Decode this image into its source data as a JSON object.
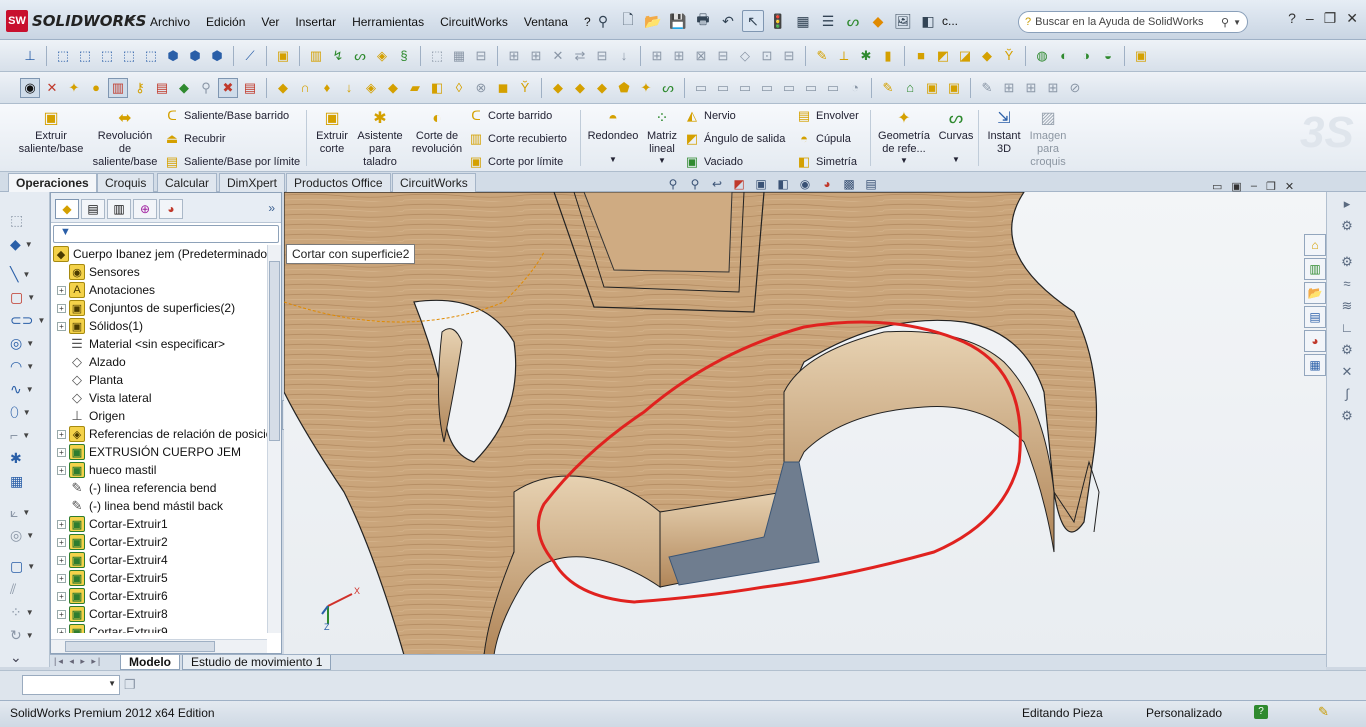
{
  "app": {
    "logo_text": "SOLIDWORKS",
    "logo_mark": "SW"
  },
  "menubar": {
    "items": [
      "Archivo",
      "Edición",
      "Ver",
      "Insertar",
      "Herramientas",
      "CircuitWorks",
      "Ventana",
      "?"
    ]
  },
  "menubar_overflow": "c...",
  "help_search": {
    "placeholder": "Buscar en la Ayuda de SolidWorks"
  },
  "command_manager": {
    "extrude_boss": "Extruir saliente/base",
    "revolve_boss": "Revolución de saliente/base",
    "swept_boss": "Saliente/Base barrido",
    "loft_boss": "Recubrir",
    "boundary_boss": "Saliente/Base por límite",
    "extrude_cut": "Extruir corte",
    "hole_wizard": "Asistente para taladro",
    "revolve_cut": "Corte de revolución",
    "swept_cut": "Corte barrido",
    "loft_cut": "Corte recubierto",
    "boundary_cut": "Corte por límite",
    "fillet": "Redondeo",
    "linear_pattern": "Matriz lineal",
    "rib": "Nervio",
    "draft": "Ángulo de salida",
    "shell": "Vaciado",
    "wrap": "Envolver",
    "dome": "Cúpula",
    "mirror": "Simetría",
    "ref_geometry": "Geometría de refe...",
    "curves": "Curvas",
    "instant3d": "Instant 3D",
    "sketch_picture": "Imagen para croquis"
  },
  "tabs": [
    "Operaciones",
    "Croquis",
    "Calcular",
    "DimXpert",
    "Productos Office",
    "CircuitWorks"
  ],
  "active_tab": "Operaciones",
  "tree": {
    "root": "Cuerpo Ibanez jem  (Predeterminado",
    "items": [
      {
        "label": "Sensores",
        "expandable": false,
        "icon": "sensor-icon"
      },
      {
        "label": "Anotaciones",
        "expandable": true,
        "icon": "annotations-icon"
      },
      {
        "label": "Conjuntos de superficies(2)",
        "expandable": true,
        "icon": "surface-bodies-icon"
      },
      {
        "label": "Sólidos(1)",
        "expandable": true,
        "icon": "solid-bodies-icon"
      },
      {
        "label": "Material <sin especificar>",
        "expandable": false,
        "icon": "material-icon"
      },
      {
        "label": "Alzado",
        "expandable": false,
        "icon": "plane-icon"
      },
      {
        "label": "Planta",
        "expandable": false,
        "icon": "plane-icon"
      },
      {
        "label": "Vista lateral",
        "expandable": false,
        "icon": "plane-icon"
      },
      {
        "label": "Origen",
        "expandable": false,
        "icon": "origin-icon"
      },
      {
        "label": "Referencias de relación de posició",
        "expandable": true,
        "icon": "mate-references-icon"
      },
      {
        "label": "EXTRUSIÓN CUERPO JEM",
        "expandable": true,
        "icon": "extrude-icon"
      },
      {
        "label": "hueco mastil",
        "expandable": true,
        "icon": "cut-icon"
      },
      {
        "label": "(-) linea referencia bend",
        "expandable": false,
        "icon": "sketch-icon"
      },
      {
        "label": "(-) linea bend mástil back",
        "expandable": false,
        "icon": "sketch-icon"
      },
      {
        "label": "Cortar-Extruir1",
        "expandable": true,
        "icon": "cut-icon"
      },
      {
        "label": "Cortar-Extruir2",
        "expandable": true,
        "icon": "cut-icon"
      },
      {
        "label": "Cortar-Extruir4",
        "expandable": true,
        "icon": "cut-icon"
      },
      {
        "label": "Cortar-Extruir5",
        "expandable": true,
        "icon": "cut-icon"
      },
      {
        "label": "Cortar-Extruir6",
        "expandable": true,
        "icon": "cut-icon"
      },
      {
        "label": "Cortar-Extruir8",
        "expandable": true,
        "icon": "cut-icon"
      },
      {
        "label": "Cortar-Extruir9",
        "expandable": true,
        "icon": "cut-icon"
      }
    ]
  },
  "tooltip": "Cortar con superficie2",
  "bottom_tabs": [
    "Modelo",
    "Estudio de movimiento 1"
  ],
  "active_bottom_tab": "Modelo",
  "status": {
    "app": "SolidWorks Premium 2012 x64 Edition",
    "mode": "Editando Pieza",
    "units": "Personalizado",
    "help": "?"
  },
  "colors": {
    "wood": "#c9a57c",
    "wood_dark": "#8e6a45",
    "annotation": "#e0221f",
    "cut_face": "#6f7d8f"
  }
}
